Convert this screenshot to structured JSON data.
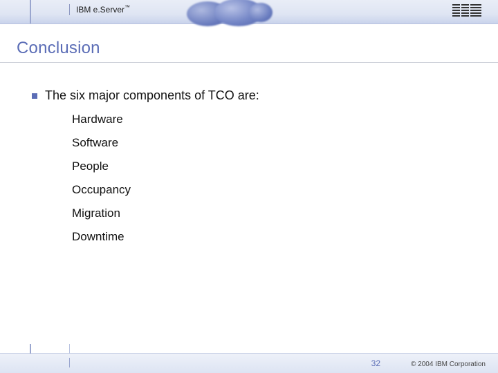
{
  "header": {
    "brand_html": "IBM e.Server",
    "brand_tm": "™"
  },
  "title": "Conclusion",
  "lead": "The six major components of TCO are:",
  "items": [
    "Hardware",
    "Software",
    "People",
    "Occupancy",
    "Migration",
    "Downtime"
  ],
  "footer": {
    "page": "32",
    "copyright": "© 2004 IBM Corporation"
  }
}
